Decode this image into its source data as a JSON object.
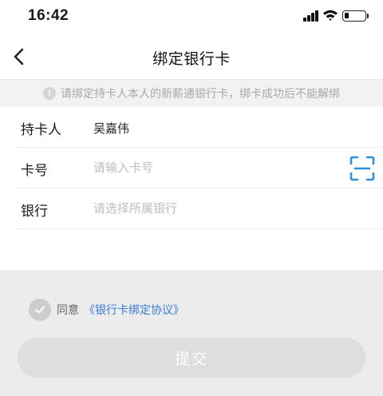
{
  "status_bar": {
    "time": "16:42",
    "icons": [
      "signal-icon",
      "wifi-icon",
      "battery-icon"
    ]
  },
  "nav": {
    "title": "绑定银行卡",
    "back_icon": "chevron-left-icon"
  },
  "notice": {
    "icon": "info-icon",
    "icon_glyph": "!",
    "text": "请绑定持卡人本人的新薪通银行卡，绑卡成功后不能解绑"
  },
  "form": {
    "cardholder": {
      "label": "持卡人",
      "value": "吴嘉伟"
    },
    "card_number": {
      "label": "卡号",
      "placeholder": "请输入卡号",
      "value": "",
      "scan_icon": "scan-icon"
    },
    "bank": {
      "label": "银行",
      "placeholder": "请选择所属银行",
      "value": ""
    }
  },
  "agreement": {
    "checked": false,
    "text": "同意",
    "link": "《银行卡绑定协议》"
  },
  "submit": {
    "label": "提交",
    "enabled": false
  },
  "colors": {
    "accent": "#3a7bd5",
    "scan_icon": "#2d8fe0",
    "background": "#ececec",
    "disabled_button": "#dedede"
  }
}
